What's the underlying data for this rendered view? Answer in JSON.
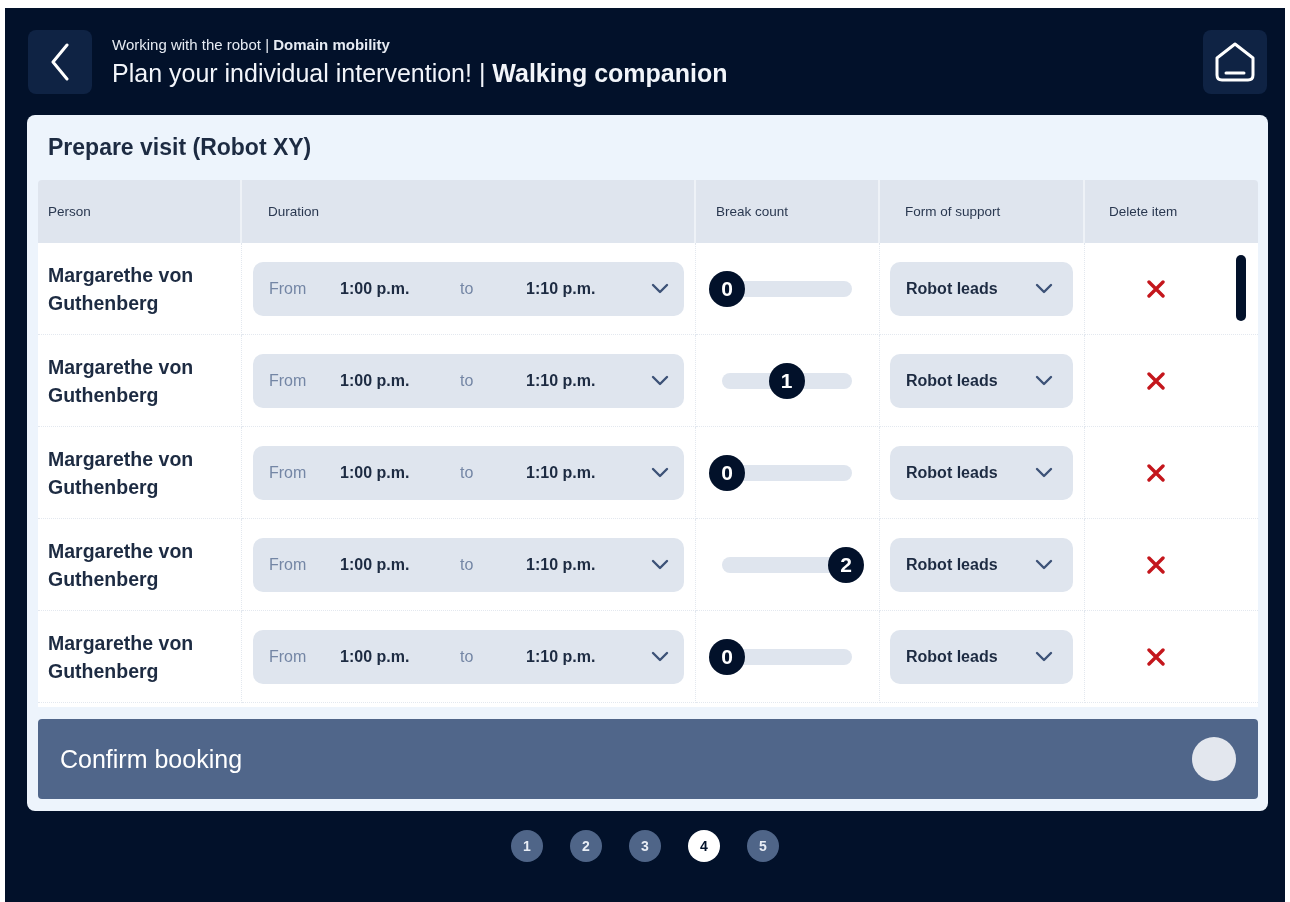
{
  "header": {
    "breadcrumb": "Working with the robot | **Domain mobility**",
    "title": "Plan your individual intervention! | **Walking companion**"
  },
  "card": {
    "title": "Prepare visit (Robot XY)",
    "columns": [
      "Person",
      "Duration",
      "Break count",
      "Form of support",
      "Delete item"
    ],
    "rows": [
      {
        "person": "Margarethe von Guthenberg",
        "from_label": "From",
        "from": "1:00 p.m.",
        "to_label": "to",
        "to": "1:10 p.m.",
        "breaks": "0",
        "level": 0,
        "support": "Robot leads"
      },
      {
        "person": "Margarethe von Guthenberg",
        "from_label": "From",
        "from": "1:00 p.m.",
        "to_label": "to",
        "to": "1:10 p.m.",
        "breaks": "1",
        "level": 0.5,
        "support": "Robot leads"
      },
      {
        "person": "Margarethe von Guthenberg",
        "from_label": "From",
        "from": "1:00 p.m.",
        "to_label": "to",
        "to": "1:10 p.m.",
        "breaks": "0",
        "level": 0,
        "support": "Robot leads"
      },
      {
        "person": "Margarethe von Guthenberg",
        "from_label": "From",
        "from": "1:00 p.m.",
        "to_label": "to",
        "to": "1:10 p.m.",
        "breaks": "2",
        "level": 1,
        "support": "Robot leads"
      },
      {
        "person": "Margarethe von Guthenberg",
        "from_label": "From",
        "from": "1:00 p.m.",
        "to_label": "to",
        "to": "1:10 p.m.",
        "breaks": "0",
        "level": 0,
        "support": "Robot leads"
      }
    ]
  },
  "confirm": {
    "label": "Confirm booking"
  },
  "steps": [
    {
      "label": "1",
      "selected": false
    },
    {
      "label": "2",
      "selected": false
    },
    {
      "label": "3",
      "selected": false
    },
    {
      "label": "4",
      "selected": true
    },
    {
      "label": "5",
      "selected": false
    }
  ]
}
